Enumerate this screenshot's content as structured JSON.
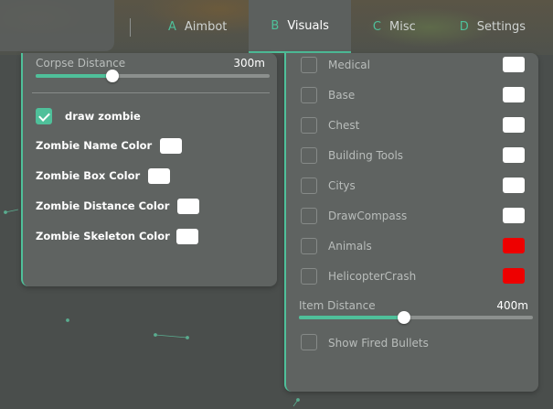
{
  "tabs": [
    {
      "letter": "A",
      "label": "Aimbot"
    },
    {
      "letter": "B",
      "label": "Visuals"
    },
    {
      "letter": "C",
      "label": "Misc"
    },
    {
      "letter": "D",
      "label": "Settings"
    }
  ],
  "left_panel": {
    "corpse_distance": {
      "label": "Corpse Distance",
      "value": "300m",
      "fraction": 0.33
    },
    "draw_zombie": {
      "label": "draw zombie",
      "checked": true
    },
    "colors": [
      {
        "label": "Zombie Name Color",
        "color": "#ffffff"
      },
      {
        "label": "Zombie Box Color",
        "color": "#ffffff"
      },
      {
        "label": "Zombie Distance Color",
        "color": "#ffffff"
      },
      {
        "label": "Zombie Skeleton Color",
        "color": "#ffffff"
      }
    ]
  },
  "right_panel": {
    "items": [
      {
        "label": "Medical",
        "checked": false,
        "color": "#ffffff"
      },
      {
        "label": "Base",
        "checked": false,
        "color": "#ffffff"
      },
      {
        "label": "Chest",
        "checked": false,
        "color": "#ffffff"
      },
      {
        "label": "Building Tools",
        "checked": false,
        "color": "#ffffff"
      },
      {
        "label": "Citys",
        "checked": false,
        "color": "#ffffff"
      },
      {
        "label": "DrawCompass",
        "checked": false,
        "color": "#ffffff"
      },
      {
        "label": "Animals",
        "checked": false,
        "color": "#ee0000"
      },
      {
        "label": "HelicopterCrash",
        "checked": false,
        "color": "#ee0000"
      }
    ],
    "item_distance": {
      "label": "Item Distance",
      "value": "400m",
      "fraction": 0.45
    },
    "show_fired_bullets": {
      "label": "Show Fired Bullets",
      "checked": false
    }
  },
  "accent_color": "#4fc09a"
}
